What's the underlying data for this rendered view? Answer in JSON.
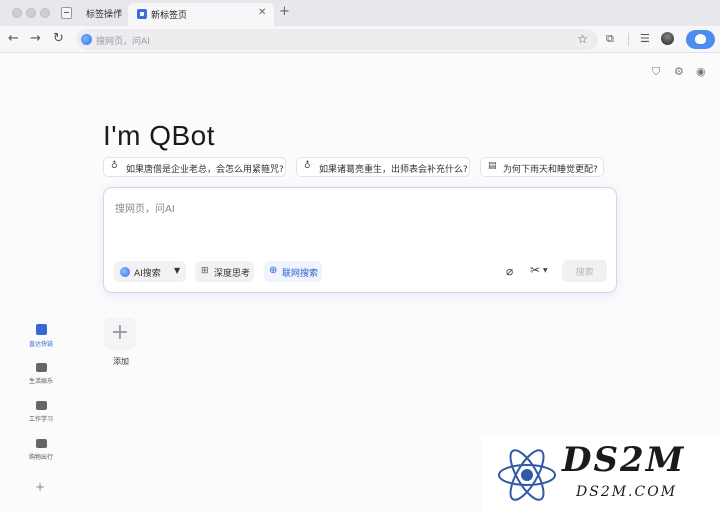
{
  "titlebar": {
    "tab_group_label": "标签操作",
    "active_tab_title": "新标签页"
  },
  "toolbar": {
    "address_placeholder": "搜网页，问AI"
  },
  "page": {
    "hero_title": "I'm QBot",
    "suggestions": [
      {
        "label": "如果唐僧是企业老总，会怎么用紧箍咒?",
        "icon": "bulb-icon"
      },
      {
        "label": "如果诸葛亮重生，出师表会补充什么?",
        "icon": "bulb-icon"
      },
      {
        "label": "为何下雨天和睡觉更配?",
        "icon": "chat-icon"
      }
    ],
    "search": {
      "placeholder": "搜网页，问AI",
      "mode_label": "AI搜索",
      "deep_think_label": "深度思考",
      "web_search_label": "联网搜索",
      "submit_label": "搜索"
    },
    "shortcut_add_label": "添加",
    "sidebar": [
      {
        "label": "直达快链",
        "active": true
      },
      {
        "label": "生活娱乐",
        "active": false
      },
      {
        "label": "工作学习",
        "active": false
      },
      {
        "label": "购物出行",
        "active": false
      }
    ]
  },
  "watermark": {
    "brand": "DS2M",
    "domain": "DS2M.COM"
  },
  "colors": {
    "accent": "#3769d8",
    "page_bg": "#fbfbfc",
    "chrome_bg": "#e8e8ec"
  }
}
